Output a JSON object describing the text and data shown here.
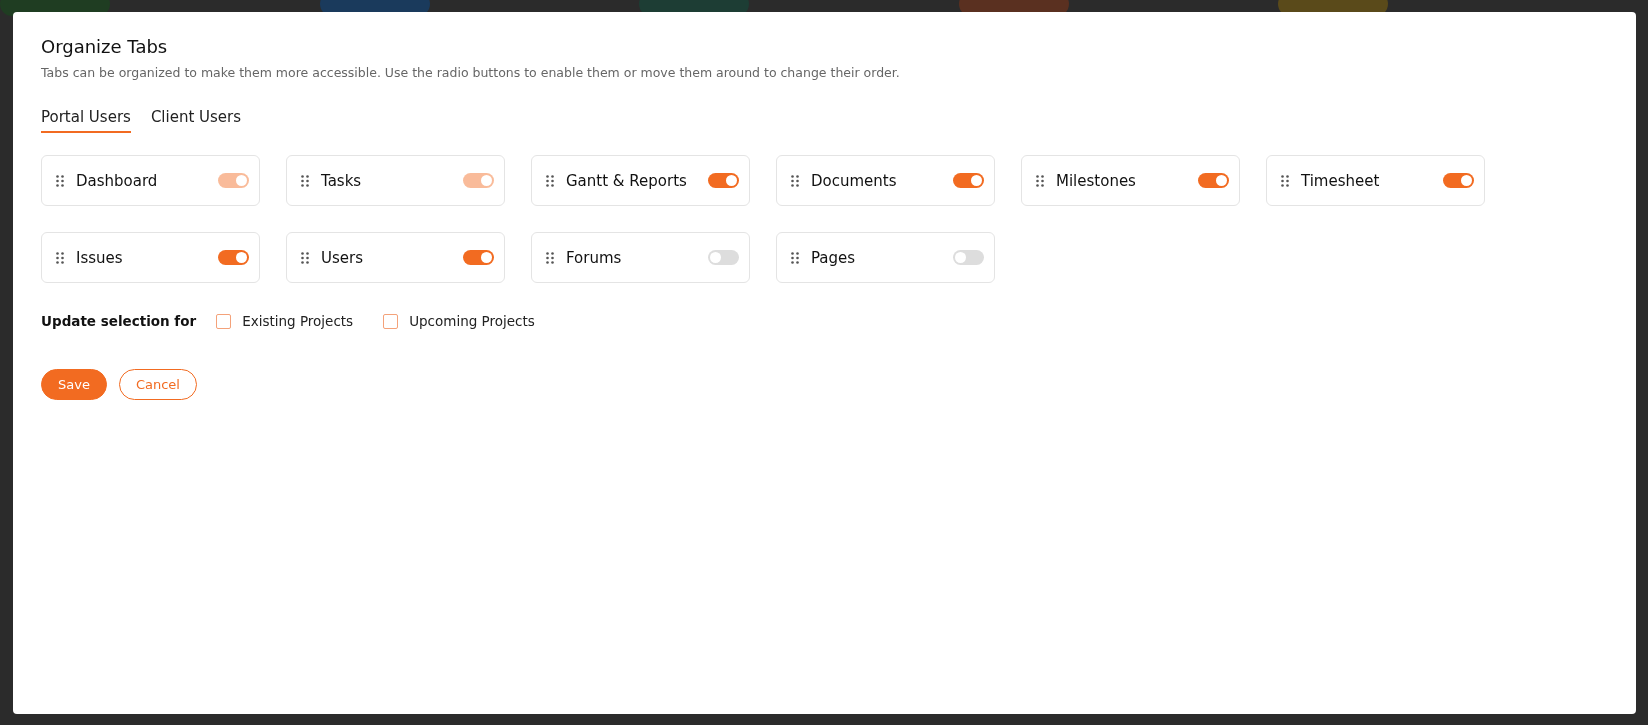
{
  "backdrop": {
    "pills": [
      {
        "color": "#1f3d22"
      },
      {
        "color": "#1a3a5c"
      },
      {
        "color": "#1d3d34"
      },
      {
        "color": "#5a3020"
      },
      {
        "color": "#5a4a1a"
      }
    ]
  },
  "dialog": {
    "title": "Organize Tabs",
    "description": "Tabs can be organized to make them more accessible. Use the radio buttons to enable them or move them around to change their order.",
    "tabs": [
      {
        "label": "Portal Users",
        "selected": true
      },
      {
        "label": "Client Users",
        "selected": false
      }
    ],
    "items": [
      {
        "label": "Dashboard",
        "on": true,
        "disabled": true
      },
      {
        "label": "Tasks",
        "on": true,
        "disabled": true
      },
      {
        "label": "Gantt & Reports",
        "on": true,
        "disabled": false
      },
      {
        "label": "Documents",
        "on": true,
        "disabled": false
      },
      {
        "label": "Milestones",
        "on": true,
        "disabled": false
      },
      {
        "label": "Timesheet",
        "on": true,
        "disabled": false
      },
      {
        "label": "Issues",
        "on": true,
        "disabled": false
      },
      {
        "label": "Users",
        "on": true,
        "disabled": false
      },
      {
        "label": "Forums",
        "on": false,
        "disabled": false
      },
      {
        "label": "Pages",
        "on": false,
        "disabled": false
      }
    ],
    "update_selection": {
      "label": "Update selection for",
      "options": [
        {
          "label": "Existing Projects",
          "checked": false
        },
        {
          "label": "Upcoming Projects",
          "checked": false
        }
      ]
    },
    "buttons": [
      {
        "label": "Save",
        "kind": "primary"
      },
      {
        "label": "Cancel",
        "kind": "secondary"
      }
    ]
  }
}
